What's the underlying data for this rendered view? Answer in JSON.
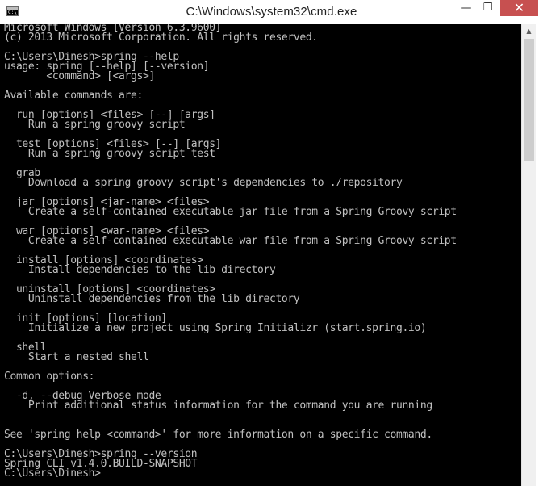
{
  "window": {
    "title": "C:\\Windows\\system32\\cmd.exe",
    "icon": "cmd-app-icon",
    "icon_text": "C:\\",
    "controls": {
      "minimize_glyph": "—",
      "maximize_glyph": "❐",
      "close_glyph": "✕"
    }
  },
  "console": {
    "foreground": "#c0c0c0",
    "background": "#000000",
    "lines": [
      "Microsoft Windows [Version 6.3.9600]",
      "(c) 2013 Microsoft Corporation. All rights reserved.",
      "",
      "C:\\Users\\Dinesh>spring --help",
      "usage: spring [--help] [--version]",
      "       <command> [<args>]",
      "",
      "Available commands are:",
      "",
      "  run [options] <files> [--] [args]",
      "    Run a spring groovy script",
      "",
      "  test [options] <files> [--] [args]",
      "    Run a spring groovy script test",
      "",
      "  grab",
      "    Download a spring groovy script's dependencies to ./repository",
      "",
      "  jar [options] <jar-name> <files>",
      "    Create a self-contained executable jar file from a Spring Groovy script",
      "",
      "  war [options] <war-name> <files>",
      "    Create a self-contained executable war file from a Spring Groovy script",
      "",
      "  install [options] <coordinates>",
      "    Install dependencies to the lib directory",
      "",
      "  uninstall [options] <coordinates>",
      "    Uninstall dependencies from the lib directory",
      "",
      "  init [options] [location]",
      "    Initialize a new project using Spring Initializr (start.spring.io)",
      "",
      "  shell",
      "    Start a nested shell",
      "",
      "Common options:",
      "",
      "  -d, --debug Verbose mode",
      "    Print additional status information for the command you are running",
      "",
      "",
      "See 'spring help <command>' for more information on a specific command.",
      "",
      "C:\\Users\\Dinesh>spring --version",
      "Spring CLI v1.4.0.BUILD-SNAPSHOT",
      "C:\\Users\\Dinesh>"
    ]
  },
  "scrollbar": {
    "up_arrow_glyph": "▲"
  }
}
